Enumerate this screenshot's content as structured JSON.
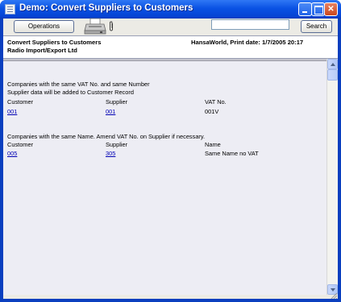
{
  "window": {
    "title": "Demo: Convert Suppliers to Customers"
  },
  "toolbar": {
    "operations_label": "Operations",
    "search_value": "",
    "search_label": "Search"
  },
  "header": {
    "report_title": "Convert Suppliers to Customers",
    "company": "Radio Import/Export Ltd",
    "print_info": "HansaWorld, Print date: 1/7/2005 20:17"
  },
  "section1": {
    "heading1": "Companies with the same VAT No. and same Number",
    "heading2": "Supplier data will be added to Customer Record",
    "columns": [
      "Customer",
      "Supplier",
      "VAT No."
    ],
    "rows": [
      {
        "customer": "001",
        "supplier": "001",
        "value": "001V"
      }
    ]
  },
  "section2": {
    "heading1": "Companies with the same Name. Amend VAT No. on Supplier if necessary.",
    "columns": [
      "Customer",
      "Supplier",
      "Name"
    ],
    "rows": [
      {
        "customer": "005",
        "supplier": "305",
        "value": "Same Name no VAT"
      }
    ]
  },
  "icons": [
    "app-icon",
    "minimize-icon",
    "maximize-icon",
    "close-icon",
    "printer-icon",
    "paperclip-icon",
    "scroll-up-arrow-icon",
    "scroll-down-arrow-icon",
    "resize-grip-icon"
  ]
}
